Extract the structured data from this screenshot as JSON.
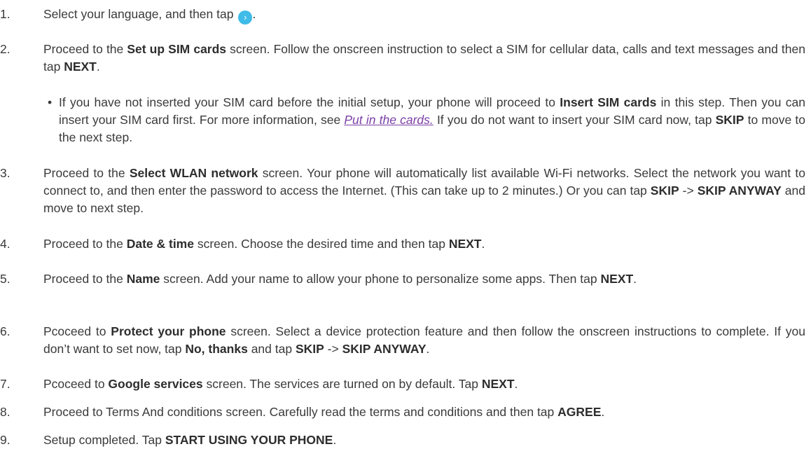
{
  "steps": [
    {
      "num": "1.",
      "parts": [
        {
          "t": "Select your language, and then tap "
        },
        {
          "icon": "next-arrow-icon",
          "glyph": "›",
          "color": "#3fbbe8"
        },
        {
          "t": "."
        }
      ]
    },
    {
      "num": "2.",
      "parts": [
        {
          "t": "Proceed to the "
        },
        {
          "b": "Set up SIM cards"
        },
        {
          "t": " screen. Follow the onscreen instruction to select a SIM for cellular data, calls and text messages and then tap "
        },
        {
          "b": "NEXT"
        },
        {
          "t": "."
        }
      ]
    },
    {
      "num": "•",
      "sub": true,
      "parts": [
        {
          "t": "If you have not inserted your SIM card before the initial setup, your phone will proceed to "
        },
        {
          "b": "Insert SIM cards"
        },
        {
          "t": " in this step. Then you can insert your SIM card first. For more information, see "
        },
        {
          "link": "Put in the cards."
        },
        {
          "t": " If you do not want to insert your SIM card now, tap "
        },
        {
          "b": "SKIP"
        },
        {
          "t": " to move to the next step."
        }
      ]
    },
    {
      "num": "3.",
      "parts": [
        {
          "t": "Proceed to the "
        },
        {
          "b": "Select WLAN network"
        },
        {
          "t": " screen. Your phone will automatically list available Wi-Fi networks. Select the network you want to connect to, and then enter the password to access the Internet. (This can take up to 2 minutes.) Or you can tap "
        },
        {
          "b": "SKIP"
        },
        {
          "t": " -> "
        },
        {
          "b": "SKIP ANYWAY"
        },
        {
          "t": " and move to next step."
        }
      ]
    },
    {
      "num": "4.",
      "parts": [
        {
          "t": "Proceed to the "
        },
        {
          "b": "Date & time"
        },
        {
          "t": " screen. Choose the desired time and then tap "
        },
        {
          "b": "NEXT"
        },
        {
          "t": "."
        }
      ]
    },
    {
      "num": "5.",
      "parts": [
        {
          "t": "Proceed to the "
        },
        {
          "b": "Name"
        },
        {
          "t": " screen. Add your name to allow your phone to personalize some apps. Then tap "
        },
        {
          "b": "NEXT"
        },
        {
          "t": "."
        }
      ]
    },
    {
      "num": "6.",
      "parts": [
        {
          "t": "Pcoceed to "
        },
        {
          "b": "Protect your phone"
        },
        {
          "t": " screen. Select a device protection feature and then follow the onscreen instructions to complete. If you don’t want to set now, tap "
        },
        {
          "b": "No, thanks"
        },
        {
          "t": " and tap "
        },
        {
          "b": "SKIP"
        },
        {
          "t": " -> "
        },
        {
          "b": "SKIP ANYWAY"
        },
        {
          "t": "."
        }
      ]
    },
    {
      "num": "7.",
      "parts": [
        {
          "t": "Pcoceed to "
        },
        {
          "b": "Google services"
        },
        {
          "t": " screen. The services are turned on by default. Tap "
        },
        {
          "b": "NEXT"
        },
        {
          "t": "."
        }
      ]
    },
    {
      "num": "8.",
      "parts": [
        {
          "t": "Proceed to Terms And conditions screen. Carefully read the terms and conditions and then tap "
        },
        {
          "b": "AGREE"
        },
        {
          "t": "."
        }
      ]
    },
    {
      "num": "9.",
      "parts": [
        {
          "t": "Setup completed. Tap "
        },
        {
          "b": "START USING YOUR PHONE"
        },
        {
          "t": "."
        }
      ]
    }
  ]
}
